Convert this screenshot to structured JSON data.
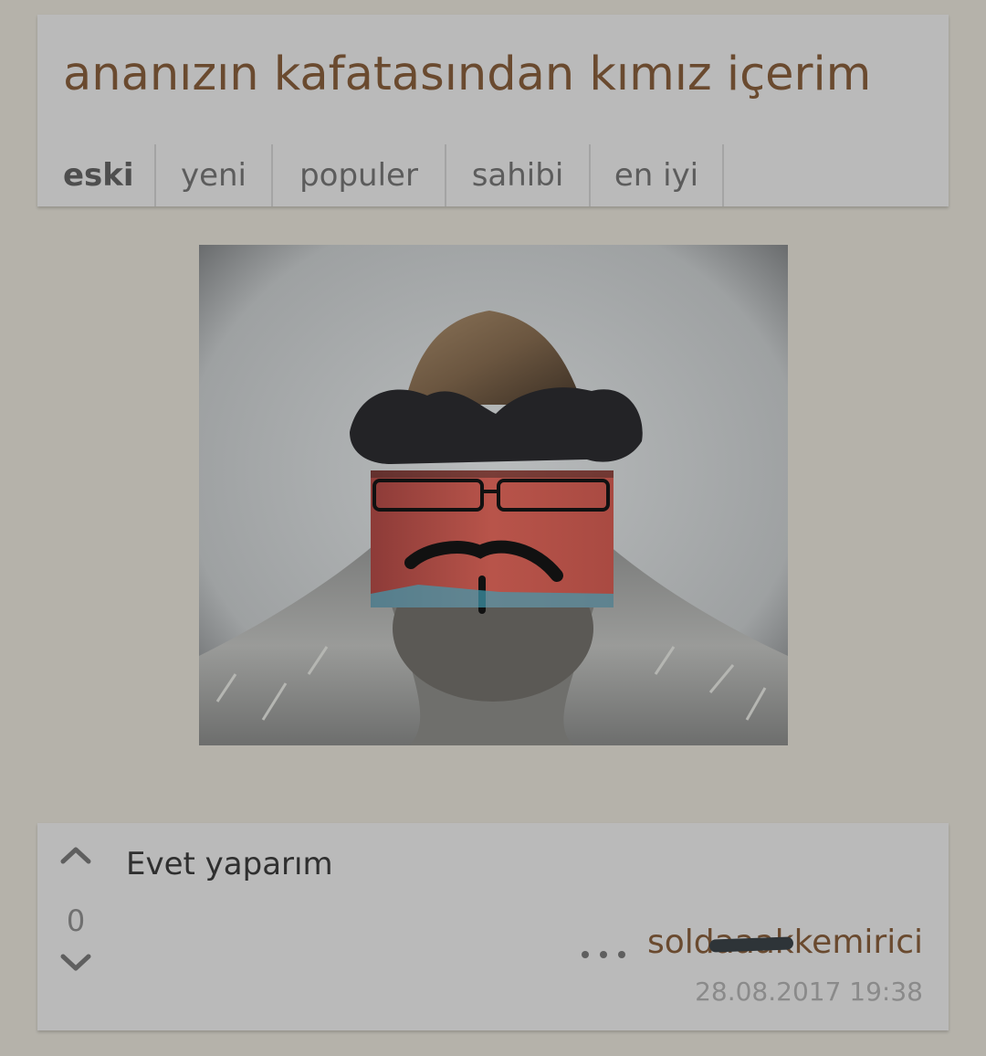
{
  "topic": {
    "title": "ananızın kafatasından kımız içerim"
  },
  "tabs": [
    {
      "label": "eski",
      "active": true
    },
    {
      "label": "yeni",
      "active": false
    },
    {
      "label": "populer",
      "active": false
    },
    {
      "label": "sahibi",
      "active": false
    },
    {
      "label": "en iyi",
      "active": false
    }
  ],
  "entry": {
    "vote_count": "0",
    "text": "Evet yaparım",
    "author": "soldaaakkemirici",
    "timestamp": "28.08.2017 19:38",
    "icons": {
      "upvote": "chevron-up-icon",
      "downvote": "chevron-down-icon",
      "more": "ellipsis-icon"
    }
  },
  "colors": {
    "background": "#b5b2aa",
    "card": "#bababa",
    "title": "#6a4a2f",
    "author": "#6a4a2f"
  }
}
